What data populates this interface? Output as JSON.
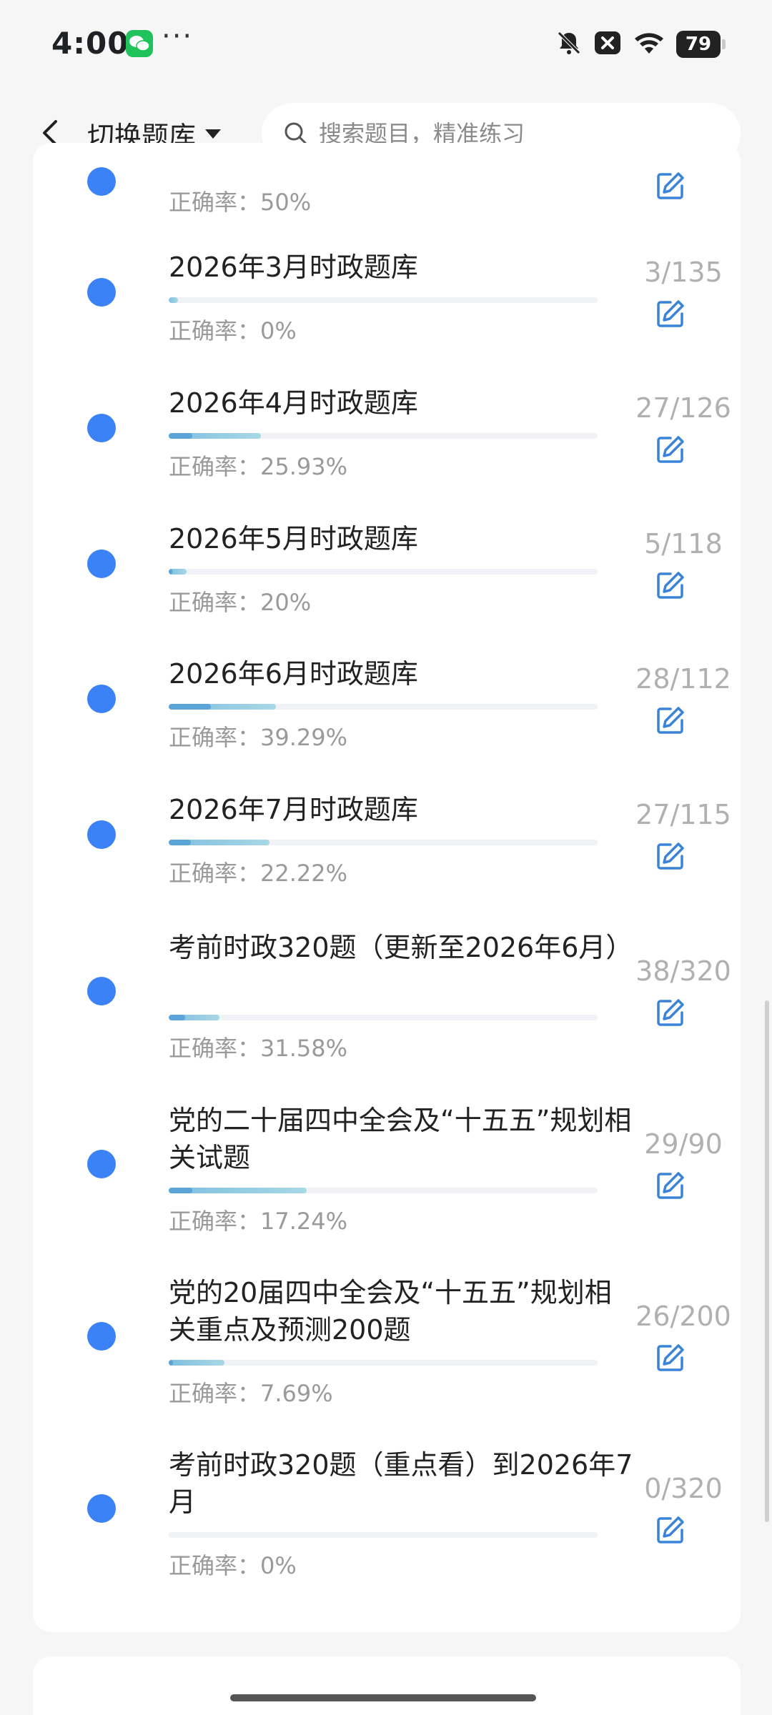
{
  "status_bar": {
    "time": "4:00",
    "more": "···",
    "battery": "79",
    "icons": [
      "wechat-icon",
      "bell-off-icon",
      "close-box-icon",
      "wifi-icon",
      "battery-icon"
    ]
  },
  "header": {
    "switch_label": "切换题库",
    "search_placeholder": "搜索题目，精准练习"
  },
  "colors": {
    "dot": "#3b82f6",
    "bar_track": "#f0f2f5",
    "bar_done": "#a8d8e6",
    "bar_correct": "#5aa4d8",
    "edit_icon": "#3a83d9"
  },
  "list": {
    "partial_accuracy": "正确率：50%",
    "items": [
      {
        "title": "2026年3月时政题库",
        "accuracy": "正确率：0%",
        "count": "3/135",
        "done": 3,
        "total": 135,
        "correct_pct": 0
      },
      {
        "title": "2026年4月时政题库",
        "accuracy": "正确率：25.93%",
        "count": "27/126",
        "done": 27,
        "total": 126,
        "correct_pct": 25.93
      },
      {
        "title": "2026年5月时政题库",
        "accuracy": "正确率：20%",
        "count": "5/118",
        "done": 5,
        "total": 118,
        "correct_pct": 20
      },
      {
        "title": "2026年6月时政题库",
        "accuracy": "正确率：39.29%",
        "count": "28/112",
        "done": 28,
        "total": 112,
        "correct_pct": 39.29
      },
      {
        "title": "2026年7月时政题库",
        "accuracy": "正确率：22.22%",
        "count": "27/115",
        "done": 27,
        "total": 115,
        "correct_pct": 22.22
      },
      {
        "title": "考前时政320题（更新至2026年6月）",
        "accuracy": "正确率：31.58%",
        "count": "38/320",
        "done": 38,
        "total": 320,
        "correct_pct": 31.58
      },
      {
        "title": "党的二十届四中全会及“十五五”规划相关试题",
        "accuracy": "正确率：17.24%",
        "count": "29/90",
        "done": 29,
        "total": 90,
        "correct_pct": 17.24
      },
      {
        "title": "党的20届四中全会及“十五五”规划相关重点及预测200题",
        "accuracy": "正确率：7.69%",
        "count": "26/200",
        "done": 26,
        "total": 200,
        "correct_pct": 7.69
      },
      {
        "title": "考前时政320题（重点看）到2026年7月",
        "accuracy": "正确率：0%",
        "count": "0/320",
        "done": 0,
        "total": 320,
        "correct_pct": 0
      }
    ]
  }
}
